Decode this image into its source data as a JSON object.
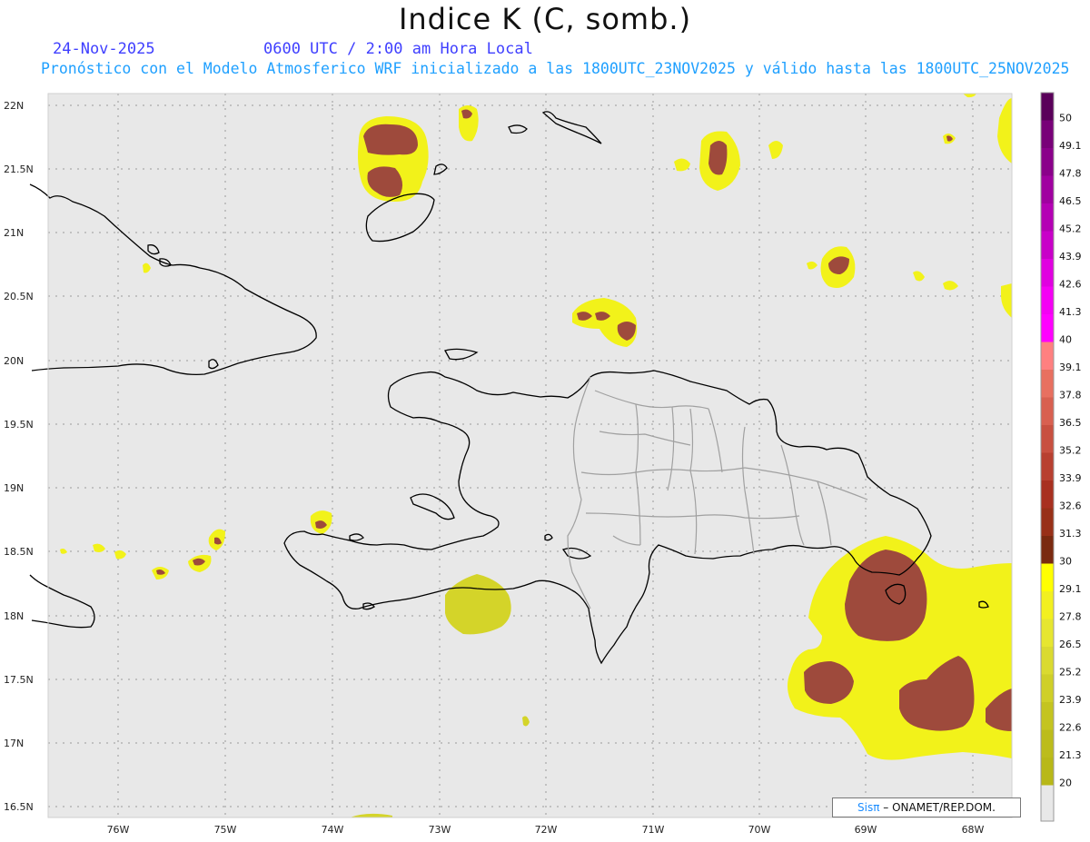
{
  "header": {
    "title": "Indice K (C, somb.)",
    "date": "24-Nov-2025",
    "time": "0600 UTC / 2:00 am Hora Local",
    "description": "Pronóstico con el Modelo Atmosferico WRF inicializado a las 1800UTC_23NOV2025 y válido hasta las  1800UTC_25NOV2025"
  },
  "axes": {
    "lat_labels": [
      "22N",
      "21.5N",
      "21N",
      "20.5N",
      "20N",
      "19.5N",
      "19N",
      "18.5N",
      "18N",
      "17.5N",
      "17N",
      "16.5N"
    ],
    "lon_labels": [
      "76W",
      "75W",
      "74W",
      "73W",
      "72W",
      "71W",
      "70W",
      "69W",
      "68W"
    ]
  },
  "colorbar": {
    "labels": [
      "50",
      "49.1",
      "47.8",
      "46.5",
      "45.2",
      "43.9",
      "42.6",
      "41.3",
      "40",
      "39.1",
      "37.8",
      "36.5",
      "35.2",
      "33.9",
      "32.6",
      "31.3",
      "30",
      "29.1",
      "27.8",
      "26.5",
      "25.2",
      "23.9",
      "22.6",
      "21.3",
      "20"
    ],
    "colors": [
      "#5a005a",
      "#780078",
      "#8a008a",
      "#a000a0",
      "#b400b4",
      "#c800c8",
      "#e000e0",
      "#f400f4",
      "#ff00ff",
      "#ff8080",
      "#e87060",
      "#d86050",
      "#c85040",
      "#b84030",
      "#a83020",
      "#983018",
      "#7a2a10",
      "#ffff00",
      "#f2f020",
      "#e6e630",
      "#dada30",
      "#cfcf28",
      "#c4c420",
      "#bcbc1c",
      "#b8b818"
    ],
    "light_color": "#e8e8e8"
  },
  "credit": {
    "brand": "Sisπ",
    "text": " – ONAMET/REP.DOM."
  },
  "colors": {
    "map_bg": "#e8e8e8",
    "coast": "#000000",
    "provinces": "#a0a0a0",
    "yellow": "#f2f21a",
    "yellow_dark": "#d4d429",
    "brown": "#9e4a3c",
    "brown_dark": "#7a2a10"
  }
}
